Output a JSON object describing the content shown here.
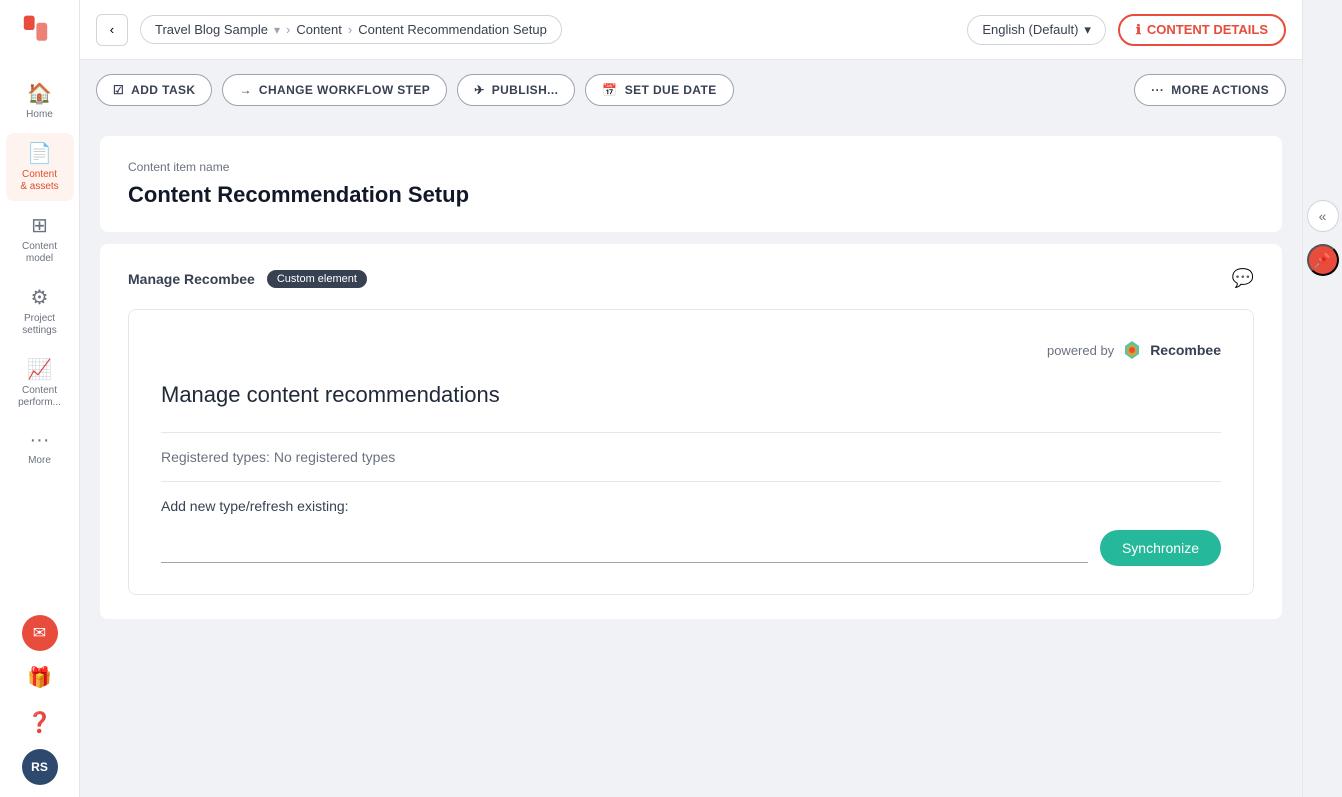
{
  "sidebar": {
    "items": [
      {
        "id": "home",
        "label": "Home",
        "icon": "🏠",
        "active": false
      },
      {
        "id": "content-assets",
        "label": "Content\n& assets",
        "icon": "📄",
        "active": true
      },
      {
        "id": "content-model",
        "label": "Content\nmodel",
        "icon": "⊞",
        "active": false
      },
      {
        "id": "project-settings",
        "label": "Project\nsettings",
        "icon": "⚙",
        "active": false
      },
      {
        "id": "content-perform",
        "label": "Content\nperform...",
        "icon": "📈",
        "active": false
      },
      {
        "id": "more",
        "label": "More",
        "icon": "···",
        "active": false
      }
    ],
    "bottom_icons": [
      "🎁",
      "❓"
    ],
    "avatar_initials": "RS",
    "notification_icon": "✉"
  },
  "header": {
    "back_button_label": "‹",
    "breadcrumb": {
      "project": "Travel Blog Sample",
      "section": "Content",
      "page": "Content Recommendation Setup"
    },
    "language": "English (Default)",
    "content_details_label": "CONTENT DETAILS"
  },
  "toolbar": {
    "add_task_label": "ADD TASK",
    "change_workflow_label": "CHANGE WORKFLOW STEP",
    "publish_label": "PUBLISH...",
    "set_due_date_label": "SET DUE DATE",
    "more_actions_label": "MORE ACTIONS"
  },
  "content_card": {
    "item_name_label": "Content item name",
    "title": "Content Recommendation Setup"
  },
  "manage_card": {
    "section_title": "Manage Recombee",
    "badge_label": "Custom element",
    "inner": {
      "powered_by_label": "powered by",
      "recombee_label": "Recombee",
      "manage_title": "Manage content recommendations",
      "registered_types_label": "Registered types:",
      "registered_types_value": "No registered types",
      "add_new_type_label": "Add new type/refresh existing:",
      "sync_button_label": "Synchronize",
      "sync_input_placeholder": ""
    }
  },
  "right_panel": {
    "collapse_icon": "«",
    "pin_icon": "📌"
  }
}
